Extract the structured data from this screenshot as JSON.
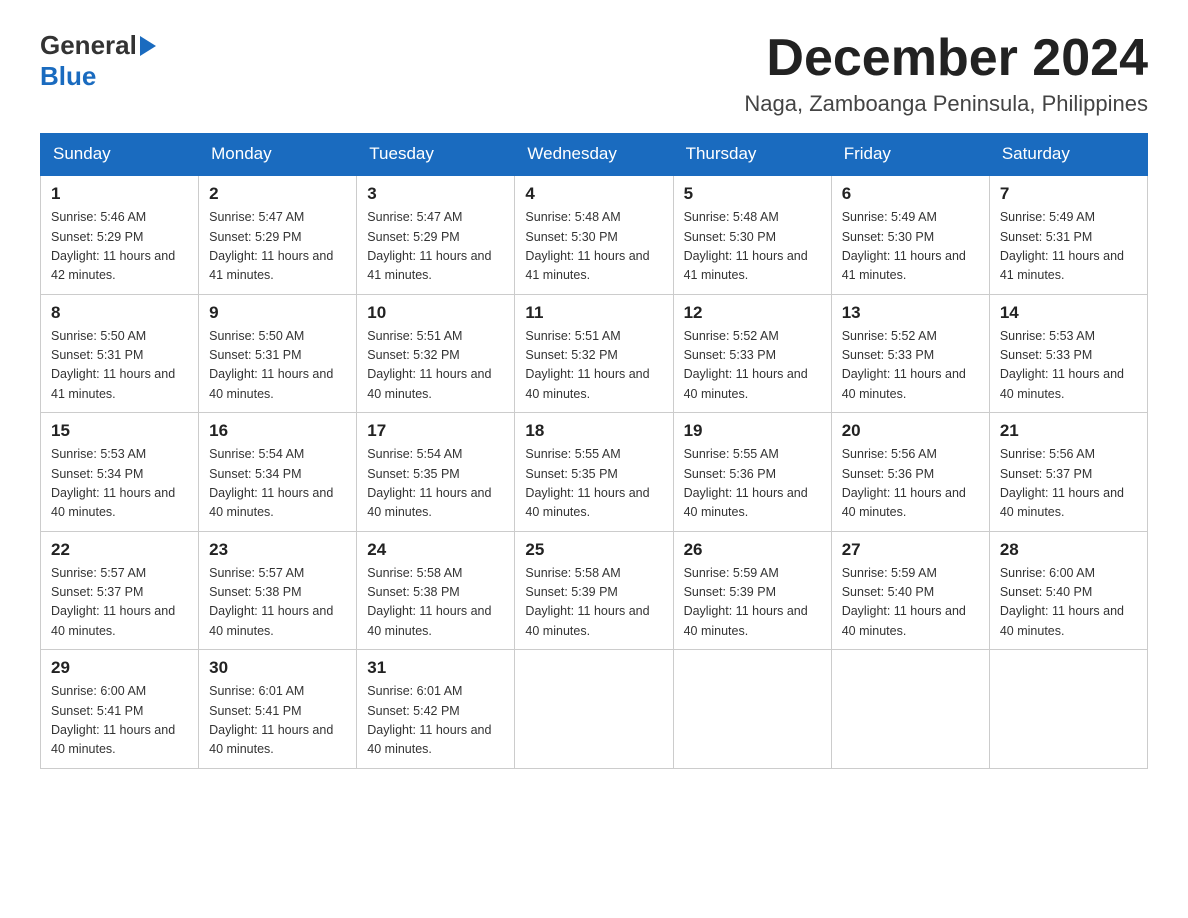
{
  "logo": {
    "general": "General",
    "blue": "Blue"
  },
  "header": {
    "month_year": "December 2024",
    "location": "Naga, Zamboanga Peninsula, Philippines"
  },
  "weekdays": [
    "Sunday",
    "Monday",
    "Tuesday",
    "Wednesday",
    "Thursday",
    "Friday",
    "Saturday"
  ],
  "weeks": [
    [
      {
        "day": "1",
        "sunrise": "5:46 AM",
        "sunset": "5:29 PM",
        "daylight": "11 hours and 42 minutes."
      },
      {
        "day": "2",
        "sunrise": "5:47 AM",
        "sunset": "5:29 PM",
        "daylight": "11 hours and 41 minutes."
      },
      {
        "day": "3",
        "sunrise": "5:47 AM",
        "sunset": "5:29 PM",
        "daylight": "11 hours and 41 minutes."
      },
      {
        "day": "4",
        "sunrise": "5:48 AM",
        "sunset": "5:30 PM",
        "daylight": "11 hours and 41 minutes."
      },
      {
        "day": "5",
        "sunrise": "5:48 AM",
        "sunset": "5:30 PM",
        "daylight": "11 hours and 41 minutes."
      },
      {
        "day": "6",
        "sunrise": "5:49 AM",
        "sunset": "5:30 PM",
        "daylight": "11 hours and 41 minutes."
      },
      {
        "day": "7",
        "sunrise": "5:49 AM",
        "sunset": "5:31 PM",
        "daylight": "11 hours and 41 minutes."
      }
    ],
    [
      {
        "day": "8",
        "sunrise": "5:50 AM",
        "sunset": "5:31 PM",
        "daylight": "11 hours and 41 minutes."
      },
      {
        "day": "9",
        "sunrise": "5:50 AM",
        "sunset": "5:31 PM",
        "daylight": "11 hours and 40 minutes."
      },
      {
        "day": "10",
        "sunrise": "5:51 AM",
        "sunset": "5:32 PM",
        "daylight": "11 hours and 40 minutes."
      },
      {
        "day": "11",
        "sunrise": "5:51 AM",
        "sunset": "5:32 PM",
        "daylight": "11 hours and 40 minutes."
      },
      {
        "day": "12",
        "sunrise": "5:52 AM",
        "sunset": "5:33 PM",
        "daylight": "11 hours and 40 minutes."
      },
      {
        "day": "13",
        "sunrise": "5:52 AM",
        "sunset": "5:33 PM",
        "daylight": "11 hours and 40 minutes."
      },
      {
        "day": "14",
        "sunrise": "5:53 AM",
        "sunset": "5:33 PM",
        "daylight": "11 hours and 40 minutes."
      }
    ],
    [
      {
        "day": "15",
        "sunrise": "5:53 AM",
        "sunset": "5:34 PM",
        "daylight": "11 hours and 40 minutes."
      },
      {
        "day": "16",
        "sunrise": "5:54 AM",
        "sunset": "5:34 PM",
        "daylight": "11 hours and 40 minutes."
      },
      {
        "day": "17",
        "sunrise": "5:54 AM",
        "sunset": "5:35 PM",
        "daylight": "11 hours and 40 minutes."
      },
      {
        "day": "18",
        "sunrise": "5:55 AM",
        "sunset": "5:35 PM",
        "daylight": "11 hours and 40 minutes."
      },
      {
        "day": "19",
        "sunrise": "5:55 AM",
        "sunset": "5:36 PM",
        "daylight": "11 hours and 40 minutes."
      },
      {
        "day": "20",
        "sunrise": "5:56 AM",
        "sunset": "5:36 PM",
        "daylight": "11 hours and 40 minutes."
      },
      {
        "day": "21",
        "sunrise": "5:56 AM",
        "sunset": "5:37 PM",
        "daylight": "11 hours and 40 minutes."
      }
    ],
    [
      {
        "day": "22",
        "sunrise": "5:57 AM",
        "sunset": "5:37 PM",
        "daylight": "11 hours and 40 minutes."
      },
      {
        "day": "23",
        "sunrise": "5:57 AM",
        "sunset": "5:38 PM",
        "daylight": "11 hours and 40 minutes."
      },
      {
        "day": "24",
        "sunrise": "5:58 AM",
        "sunset": "5:38 PM",
        "daylight": "11 hours and 40 minutes."
      },
      {
        "day": "25",
        "sunrise": "5:58 AM",
        "sunset": "5:39 PM",
        "daylight": "11 hours and 40 minutes."
      },
      {
        "day": "26",
        "sunrise": "5:59 AM",
        "sunset": "5:39 PM",
        "daylight": "11 hours and 40 minutes."
      },
      {
        "day": "27",
        "sunrise": "5:59 AM",
        "sunset": "5:40 PM",
        "daylight": "11 hours and 40 minutes."
      },
      {
        "day": "28",
        "sunrise": "6:00 AM",
        "sunset": "5:40 PM",
        "daylight": "11 hours and 40 minutes."
      }
    ],
    [
      {
        "day": "29",
        "sunrise": "6:00 AM",
        "sunset": "5:41 PM",
        "daylight": "11 hours and 40 minutes."
      },
      {
        "day": "30",
        "sunrise": "6:01 AM",
        "sunset": "5:41 PM",
        "daylight": "11 hours and 40 minutes."
      },
      {
        "day": "31",
        "sunrise": "6:01 AM",
        "sunset": "5:42 PM",
        "daylight": "11 hours and 40 minutes."
      },
      null,
      null,
      null,
      null
    ]
  ]
}
